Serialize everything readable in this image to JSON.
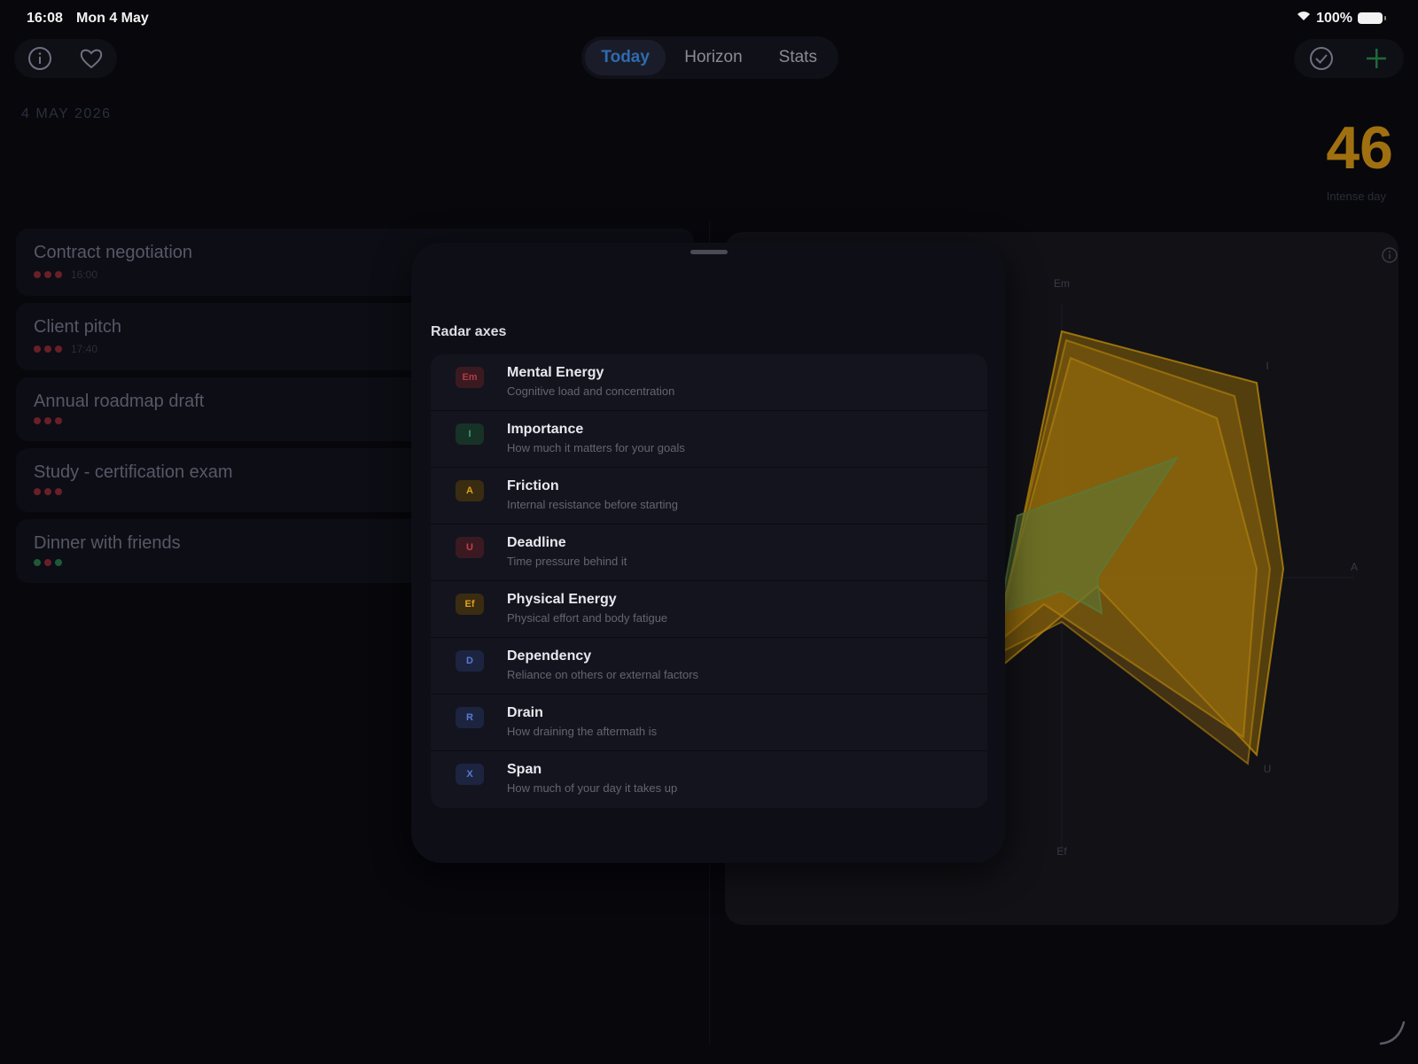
{
  "status": {
    "time": "16:08",
    "date": "Mon 4 May",
    "battery": "100%"
  },
  "tabs": [
    {
      "label": "Today",
      "active": true
    },
    {
      "label": "Horizon",
      "active": false
    },
    {
      "label": "Stats",
      "active": false
    }
  ],
  "header": {
    "date": "4 MAY 2026",
    "score": "46",
    "score_caption": "Intense day"
  },
  "tasks": [
    {
      "title": "Contract negotiation",
      "dots": [
        "red",
        "red",
        "red"
      ],
      "time": "16:00"
    },
    {
      "title": "Client pitch",
      "dots": [
        "red",
        "red",
        "red"
      ],
      "time": "17:40"
    },
    {
      "title": "Annual roadmap draft",
      "dots": [
        "red",
        "red",
        "red"
      ],
      "time": ""
    },
    {
      "title": "Study - certification exam",
      "dots": [
        "red",
        "red",
        "red"
      ],
      "time": ""
    },
    {
      "title": "Dinner with friends",
      "dots": [
        "green",
        "red",
        "green"
      ],
      "time": ""
    }
  ],
  "radar": {
    "axis_labels": [
      "Em",
      "I",
      "A",
      "U",
      "Ef"
    ],
    "colors": {
      "primary": "#b8860b",
      "secondary": "#5a7a3a"
    }
  },
  "sheet": {
    "title": "Radar axes",
    "axes": [
      {
        "code": "Em",
        "name": "Mental Energy",
        "description": "Cognitive load and concentration",
        "color": "#b03a48",
        "bg": "#3a1a20"
      },
      {
        "code": "I",
        "name": "Importance",
        "description": "How much it matters for your goals",
        "color": "#3aa070",
        "bg": "#173226"
      },
      {
        "code": "A",
        "name": "Friction",
        "description": "Internal resistance before starting",
        "color": "#e0a020",
        "bg": "#3a2c10"
      },
      {
        "code": "U",
        "name": "Deadline",
        "description": "Time pressure behind it",
        "color": "#c04050",
        "bg": "#3a1a20"
      },
      {
        "code": "Ef",
        "name": "Physical Energy",
        "description": "Physical effort and body fatigue",
        "color": "#e0a020",
        "bg": "#3a2c10"
      },
      {
        "code": "D",
        "name": "Dependency",
        "description": "Reliance on others or external factors",
        "color": "#5a7ad0",
        "bg": "#1c2440"
      },
      {
        "code": "R",
        "name": "Drain",
        "description": "How draining the aftermath is",
        "color": "#5a7ad0",
        "bg": "#1c2440"
      },
      {
        "code": "X",
        "name": "Span",
        "description": "How much of your day it takes up",
        "color": "#5a7ad0",
        "bg": "#1c2440"
      }
    ]
  }
}
